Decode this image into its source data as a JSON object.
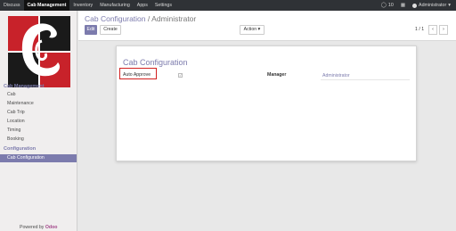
{
  "topbar": {
    "menu": [
      "Discuss",
      "Cab Management",
      "Inventory",
      "Manufacturing",
      "Apps",
      "Settings"
    ],
    "active_menu": "Cab Management",
    "messages_count": "10",
    "user_name": "Administrator"
  },
  "sidebar": {
    "section1_title": "Cab Management",
    "items1": [
      "Cab",
      "Maintenance",
      "Cab Trip",
      "Location",
      "Timing",
      "Booking"
    ],
    "section2_title": "Configuration",
    "items2": [
      "Cab Configuration"
    ],
    "powered_by": "Powered by",
    "powered_brand": "Odoo",
    "logo_colors": {
      "red": "#c8222a",
      "black": "#1a1a1a"
    }
  },
  "control": {
    "breadcrumb_parent": "Cab Configuration",
    "breadcrumb_sep": "/",
    "breadcrumb_current": "Administrator",
    "edit_label": "Edit",
    "create_label": "Create",
    "action_label": "Action",
    "pager": "1 / 1",
    "prev_icon": "chevron-left-icon",
    "next_icon": "chevron-right-icon"
  },
  "form": {
    "title": "Cab Configuration",
    "auto_approve_label": "Auto Approve",
    "auto_approve_checked": true,
    "manager_label": "Manager",
    "manager_value": "Administrator"
  },
  "colors": {
    "accent": "#7c7bad",
    "topbar": "#2f3236",
    "highlight": "#d21f1f"
  }
}
